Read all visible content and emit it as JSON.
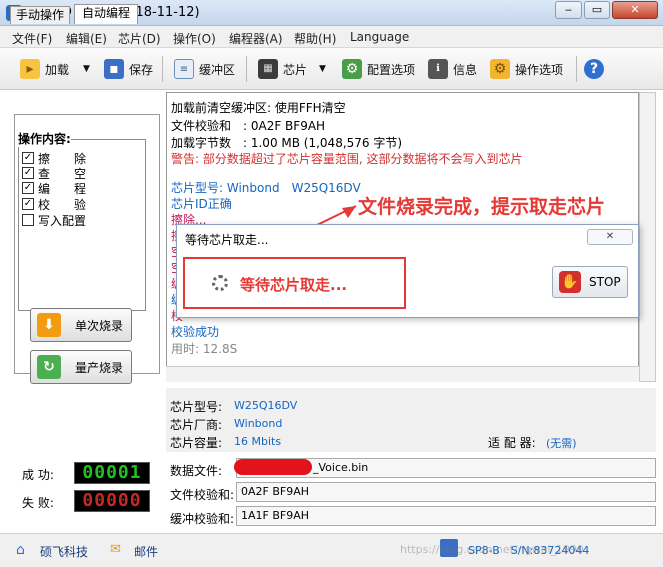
{
  "window": {
    "title": "FlyPRO V4.46(2018-11-12)",
    "app_icon_glyph": "F"
  },
  "menu": [
    "文件(F)",
    "编辑(E)",
    "芯片(D)",
    "操作(O)",
    "编程器(A)",
    "帮助(H)",
    "Language"
  ],
  "toolbar": {
    "load": "加载",
    "save": "保存",
    "buffer": "缓冲区",
    "chip": "芯片",
    "config": "配置选项",
    "info": "信息",
    "operation": "操作选项"
  },
  "tabs": {
    "manual": "手动操作",
    "auto": "自动编程"
  },
  "operations": {
    "title": "操作内容:",
    "items": [
      {
        "label": "擦　　除",
        "checked": true
      },
      {
        "label": "查　　空",
        "checked": true
      },
      {
        "label": "编　　程",
        "checked": true
      },
      {
        "label": "校　　验",
        "checked": true
      },
      {
        "label": "写入配置",
        "checked": false
      }
    ]
  },
  "buttons": {
    "single_burn": "单次烧录",
    "mass_burn": "量产烧录"
  },
  "counters": {
    "success_label": "成 功:",
    "success_value": "00001",
    "fail_label": "失 败:",
    "fail_value": "00000"
  },
  "log": [
    {
      "text": "加载前清空缓冲区: 使用FFH清空",
      "color": "#000"
    },
    {
      "text": "文件校验和　: 0A2F BF9AH",
      "color": "#000"
    },
    {
      "text": "加载字节数　: 1.00 MB (1,048,576 字节)",
      "color": "#000"
    },
    {
      "text": "警告: 部分数据超过了芯片容量范围, 这部分数据将不会写入到芯片",
      "color": "#d32f2f"
    },
    {
      "text": "",
      "color": "#000"
    },
    {
      "text": "芯片型号: Winbond　W25Q16DV",
      "color": "#1565c0"
    },
    {
      "text": "芯片ID正确",
      "color": "#1565c0"
    },
    {
      "text": "擦除...",
      "color": "#c2185b"
    },
    {
      "text": "擦",
      "color": "#c2185b"
    },
    {
      "text": "空",
      "color": "#c2185b"
    },
    {
      "text": "空",
      "color": "#c2185b"
    },
    {
      "text": "编",
      "color": "#c2185b"
    },
    {
      "text": "编",
      "color": "#1565c0"
    },
    {
      "text": "校",
      "color": "#c2185b"
    },
    {
      "text": "校验成功",
      "color": "#1565c0"
    },
    {
      "text": "用时: 12.8S",
      "color": "#888"
    }
  ],
  "chip_info": {
    "model_label": "芯片型号:",
    "model_value": "W25Q16DV",
    "vendor_label": "芯片厂商:",
    "vendor_value": "Winbond",
    "capacity_label": "芯片容量:",
    "capacity_value": "16 Mbits",
    "adapter_label": "适 配 器:",
    "adapter_value": "(无需)"
  },
  "files": {
    "data_file_label": "数据文件:",
    "data_file_value": "_Voice.bin",
    "file_checksum_label": "文件校验和:",
    "file_checksum_value": "0A2F BF9AH",
    "buffer_checksum_label": "缓冲校验和:",
    "buffer_checksum_value": "1A1F BF9AH"
  },
  "status": {
    "company": "硕飞科技",
    "mail": "邮件",
    "device": "SP8-B　S/N:83724044",
    "watermark": "https://blog.csdn.net/ngwei_1990"
  },
  "dialog": {
    "title": "等待芯片取走...",
    "message": "等待芯片取走...",
    "stop": "STOP",
    "close_glyph": "✕"
  },
  "annotation": "文件烧录完成，提示取走芯片",
  "colors": {
    "accent_red": "#e53935",
    "link_blue": "#1565c0",
    "counter_green": "#22c122",
    "counter_red": "#c62828"
  }
}
